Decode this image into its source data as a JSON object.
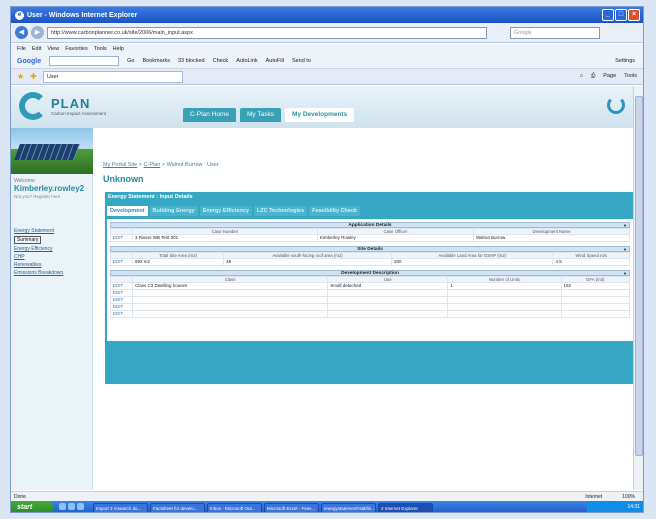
{
  "browser": {
    "title": "User - Windows Internet Explorer",
    "url": "http://www.carbonplanner.co.uk/site/2006/main_input.aspx",
    "search_placeholder": "Google",
    "menu": [
      "File",
      "Edit",
      "View",
      "Favorites",
      "Tools",
      "Help"
    ],
    "google_toolbar": [
      "Go",
      "Bookmarks",
      "33 blocked",
      "Check",
      "AutoLink",
      "AutoFill",
      "Send to"
    ],
    "google_settings": "Settings",
    "tab_title": "User",
    "tab_tools": [
      "Page",
      "Tools"
    ],
    "status": "Done",
    "zone": "Internet",
    "zoom": "100%"
  },
  "site": {
    "logo_name": "PLAN",
    "logo_sub": "Carbon Impact Assessment",
    "tabs": [
      "C-Plan Home",
      "My Tasks",
      "My Developments"
    ],
    "active_tab": 2
  },
  "sidebar": {
    "welcome": "Welcome",
    "username": "Kimberley.rowley2",
    "not_you": "Not you? Register here",
    "menu": [
      "Energy Statement",
      "Summary",
      "Energy Efficiency",
      "CHP",
      "Renewables",
      "Emissions Breakdown"
    ]
  },
  "main": {
    "breadcrumb": [
      "My Portal Site",
      "C-Plan",
      "Walnut Burrow : User"
    ],
    "title": "Unknown",
    "panel_heading": "Energy Statement : Input Details",
    "subtabs": [
      "Development",
      "Building Energy",
      "Energy Efficiency",
      "LZC Technologies",
      "Feasibility Check"
    ],
    "active_subtab": 0
  },
  "application": {
    "title": "Application Details",
    "headers": [
      "",
      "Case Number",
      "Case Officer",
      "Development Name"
    ],
    "rows": [
      [
        "EDIT",
        "3 Rivers WB Test 001",
        "Kimberley Rowley",
        "Walnut Burrow"
      ]
    ]
  },
  "site_details": {
    "title": "Site Details",
    "headers": [
      "",
      "Total Site Area (m2)",
      "Available south-facing roof area (m2)",
      "Available Land Area for GSHP (m2)",
      "Wind Speed m/s"
    ],
    "rows": [
      [
        "EDIT",
        "992 m2",
        "45",
        "200",
        "4.5"
      ]
    ]
  },
  "development": {
    "title": "Development Description",
    "headers": [
      "",
      "Class",
      "Use",
      "Number of Units",
      "GFA (m2)"
    ],
    "rows": [
      [
        "EDIT",
        "Class C3 Dwelling houses",
        "Small detached",
        "1",
        "192"
      ],
      [
        "EDIT",
        "",
        "",
        "",
        ""
      ],
      [
        "EDIT",
        "",
        "",
        "",
        ""
      ],
      [
        "EDIT",
        "",
        "",
        "",
        ""
      ],
      [
        "EDIT",
        "",
        "",
        "",
        ""
      ]
    ]
  },
  "taskbar": {
    "start": "start",
    "items": [
      "Import 3 research do...",
      "Factsheet for develo...",
      "Inbox - Microsoft Out...",
      "Microsoft Excel - Fees...",
      "energystatement%5bfin...",
      "2 Internet Explorer"
    ],
    "clock": "14:31"
  }
}
